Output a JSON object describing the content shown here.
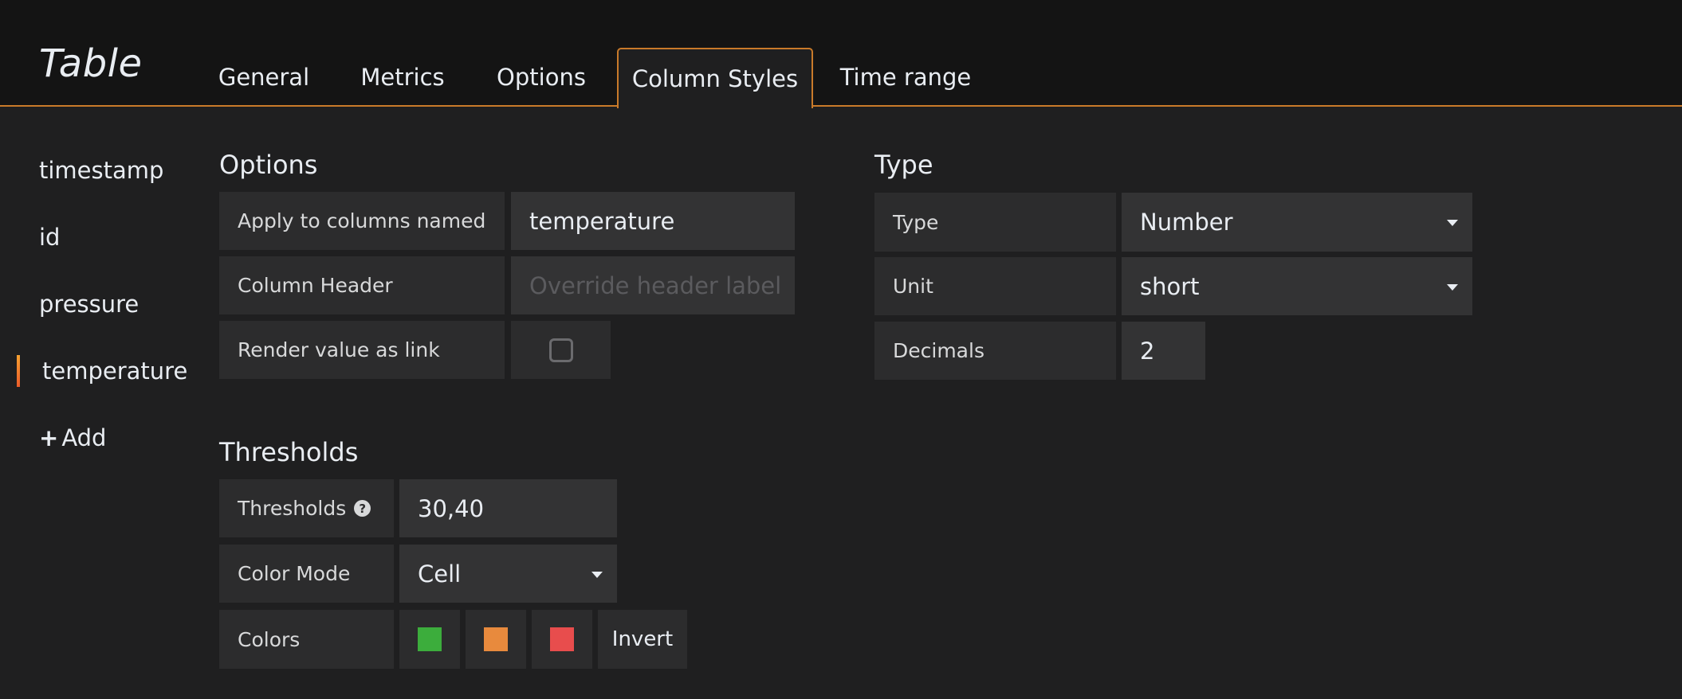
{
  "panel": {
    "title": "Table"
  },
  "tabs": [
    {
      "label": "General"
    },
    {
      "label": "Metrics"
    },
    {
      "label": "Options"
    },
    {
      "label": "Column Styles"
    },
    {
      "label": "Time range"
    }
  ],
  "sidebar": {
    "items": [
      {
        "label": "timestamp"
      },
      {
        "label": "id"
      },
      {
        "label": "pressure"
      },
      {
        "label": "temperature"
      }
    ],
    "add_label": "Add",
    "accent": "#f7a130"
  },
  "options": {
    "title": "Options",
    "apply_label": "Apply to columns named",
    "apply_value": "temperature",
    "header_label": "Column Header",
    "header_placeholder": "Override header label",
    "link_label": "Render value as link"
  },
  "type_section": {
    "title": "Type",
    "type_label": "Type",
    "type_value": "Number",
    "unit_label": "Unit",
    "unit_value": "short",
    "decimals_label": "Decimals",
    "decimals_value": "2"
  },
  "thresholds": {
    "title": "Thresholds",
    "thresholds_label": "Thresholds",
    "thresholds_value": "30,40",
    "color_mode_label": "Color Mode",
    "color_mode_value": "Cell",
    "colors_label": "Colors",
    "colors": [
      "#3cad3c",
      "#e88a3d",
      "#e84d4d"
    ],
    "invert_label": "Invert"
  }
}
